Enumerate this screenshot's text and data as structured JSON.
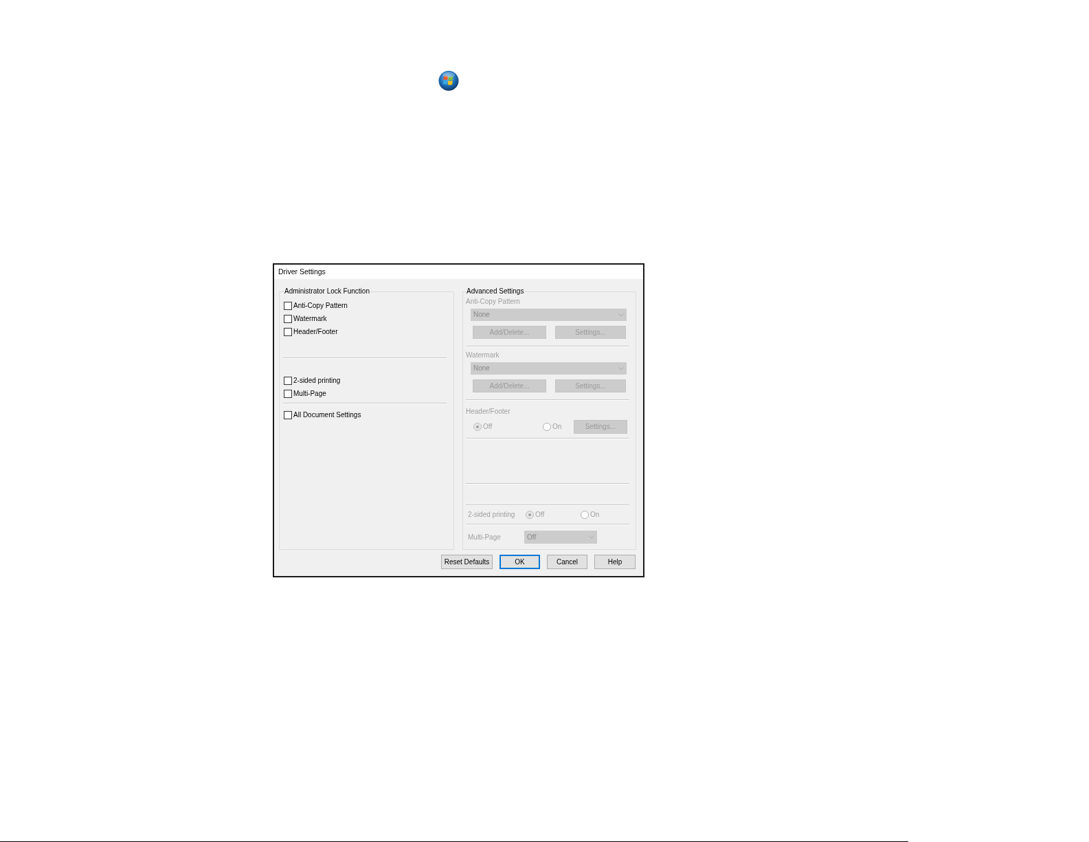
{
  "dialog": {
    "title": "Driver Settings",
    "lock_group": {
      "title": "Administrator Lock Function",
      "sections": [
        {
          "items": [
            {
              "label": "Anti-Copy Pattern",
              "checked": false
            },
            {
              "label": "Watermark",
              "checked": false
            },
            {
              "label": "Header/Footer",
              "checked": false
            }
          ]
        },
        {
          "items": [
            {
              "label": "2-sided printing",
              "checked": false
            },
            {
              "label": "Multi-Page",
              "checked": false
            }
          ]
        },
        {
          "items": [
            {
              "label": "All Document Settings",
              "checked": false
            }
          ]
        }
      ]
    },
    "advanced_group": {
      "title": "Advanced Settings",
      "disabled": true,
      "sections": [
        {
          "kind": "select_buttons",
          "label": "Anti-Copy Pattern",
          "select": {
            "value": "None"
          },
          "buttons": [
            "Add/Delete...",
            "Settings..."
          ]
        },
        {
          "kind": "select_buttons",
          "label": "Watermark",
          "select": {
            "value": "None"
          },
          "buttons": [
            "Add/Delete...",
            "Settings..."
          ]
        },
        {
          "kind": "radio_button",
          "label": "Header/Footer",
          "options": [
            {
              "label": "Off",
              "selected": true
            },
            {
              "label": "On",
              "selected": false
            }
          ],
          "button": "Settings..."
        },
        {
          "kind": "radio_inline",
          "label": "2-sided printing",
          "options": [
            {
              "label": "Off",
              "selected": true
            },
            {
              "label": "On",
              "selected": false
            }
          ]
        },
        {
          "kind": "select_inline",
          "label": "Multi-Page",
          "select": {
            "value": "Off"
          }
        }
      ]
    },
    "buttons": [
      {
        "label": "Reset Defaults",
        "focused": false
      },
      {
        "label": "OK",
        "focused": true
      },
      {
        "label": "Cancel",
        "focused": false
      },
      {
        "label": "Help",
        "focused": false
      }
    ]
  }
}
